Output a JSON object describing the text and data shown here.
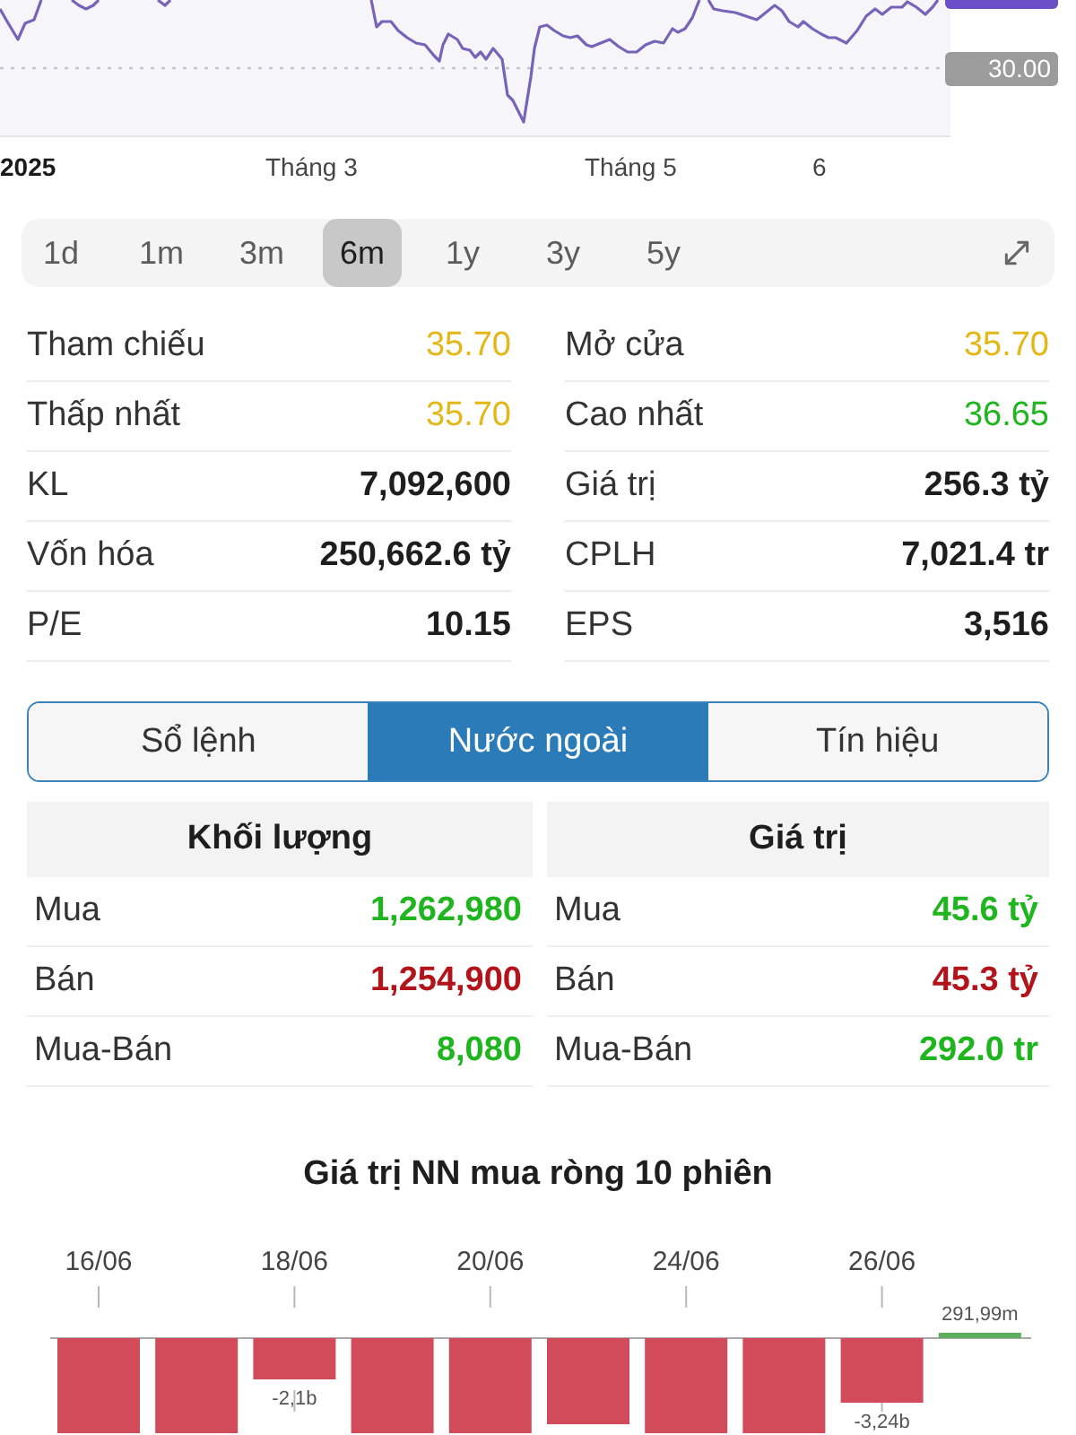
{
  "price_chart": {
    "axis_label": "30.00",
    "x_labels": [
      {
        "label": "2025",
        "kind": "year"
      },
      {
        "label": "Tháng 3",
        "kind": "month"
      },
      {
        "label": "Tháng 5",
        "kind": "month"
      },
      {
        "label": "6",
        "kind": "month"
      }
    ]
  },
  "periods": [
    {
      "label": "1d",
      "selected": false
    },
    {
      "label": "1m",
      "selected": false
    },
    {
      "label": "3m",
      "selected": false
    },
    {
      "label": "6m",
      "selected": true
    },
    {
      "label": "1y",
      "selected": false
    },
    {
      "label": "3y",
      "selected": false
    },
    {
      "label": "5y",
      "selected": false
    }
  ],
  "stats": [
    {
      "label": "Tham chiếu",
      "value": "35.70",
      "kind": "price",
      "color": "#e3b716"
    },
    {
      "label": "Mở cửa",
      "value": "35.70",
      "kind": "price",
      "color": "#e3b716"
    },
    {
      "label": "Thấp nhất",
      "value": "35.70",
      "kind": "price",
      "color": "#e3b716"
    },
    {
      "label": "Cao nhất",
      "value": "36.65",
      "kind": "price",
      "color": "#1fb51f"
    },
    {
      "label": "KL",
      "value": "7,092,600",
      "kind": "figure"
    },
    {
      "label": "Giá trị",
      "value": "256.3 tỷ",
      "kind": "figure"
    },
    {
      "label": "Vốn hóa",
      "value": "250,662.6 tỷ",
      "kind": "figure"
    },
    {
      "label": "CPLH",
      "value": "7,021.4 tr",
      "kind": "figure"
    },
    {
      "label": "P/E",
      "value": "10.15",
      "kind": "figure"
    },
    {
      "label": "EPS",
      "value": "3,516",
      "kind": "figure"
    }
  ],
  "segments": [
    {
      "label": "Sổ lệnh",
      "selected": false
    },
    {
      "label": "Nước ngoài",
      "selected": true
    },
    {
      "label": "Tín hiệu",
      "selected": false
    }
  ],
  "foreign": [
    {
      "title": "Khối lượng",
      "rows": [
        {
          "label": "Mua",
          "value": "1,262,980",
          "color": "#1fb51f"
        },
        {
          "label": "Bán",
          "value": "1,254,900",
          "color": "#b3141c"
        },
        {
          "label": "Mua-Bán",
          "value": "8,080",
          "color": "#1fb51f"
        }
      ]
    },
    {
      "title": "Giá trị",
      "rows": [
        {
          "label": "Mua",
          "value": "45.6 tỷ",
          "color": "#1fb51f"
        },
        {
          "label": "Bán",
          "value": "45.3 tỷ",
          "color": "#b3141c"
        },
        {
          "label": "Mua-Bán",
          "value": "292.0 tr",
          "color": "#1fb51f"
        }
      ]
    }
  ],
  "net_chart": {
    "title": "Giá trị NN mua ròng 10 phiên",
    "dates": [
      "16/06",
      "18/06",
      "20/06",
      "24/06",
      "26/06"
    ],
    "bars": [
      {
        "kind": "sell"
      },
      {
        "kind": "sell"
      },
      {
        "kind": "sell",
        "value_label": "-2,1b"
      },
      {
        "kind": "sell"
      },
      {
        "kind": "sell"
      },
      {
        "kind": "sell"
      },
      {
        "kind": "sell"
      },
      {
        "kind": "sell"
      },
      {
        "kind": "sell",
        "value_label": "-3,24b"
      },
      {
        "kind": "buy",
        "value_label": "291,99m"
      }
    ]
  }
}
